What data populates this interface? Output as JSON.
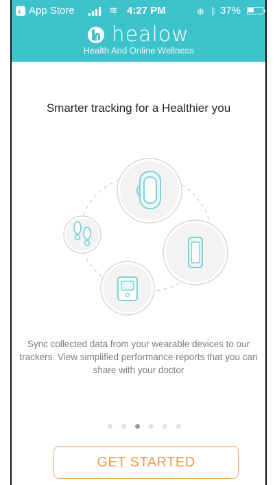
{
  "status_bar": {
    "back_app": "App Store",
    "time": "4:27 PM",
    "battery": "37%"
  },
  "header": {
    "brand": "healow",
    "tagline": "Health And Online Wellness",
    "color": "#3ec3cd"
  },
  "onboarding": {
    "headline": "Smarter tracking for a Healthier you",
    "description": "Sync collected data from your wearable devices to our trackers. View simplified performance reports that you can share with your doctor",
    "page_count": 6,
    "active_page": 3,
    "illustration_items": [
      "wristband-icon",
      "phone-icon",
      "scale-icon",
      "footsteps-icon"
    ]
  },
  "cta": {
    "label": "GET STARTED",
    "color": "#f09a4f"
  }
}
